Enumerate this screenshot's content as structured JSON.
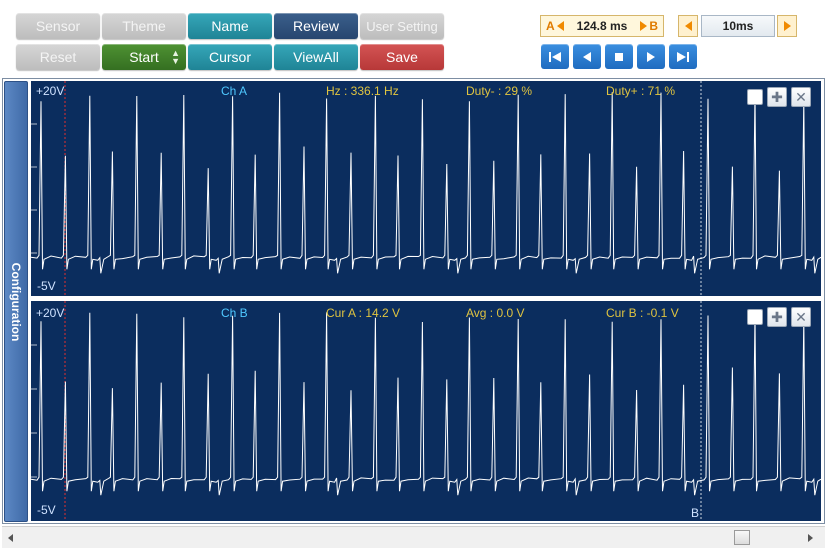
{
  "toolbar": {
    "row1": [
      {
        "id": "sensor",
        "label": "Sensor",
        "style": "gray"
      },
      {
        "id": "theme",
        "label": "Theme",
        "style": "gray"
      },
      {
        "id": "name",
        "label": "Name",
        "style": "teal"
      },
      {
        "id": "review",
        "label": "Review",
        "style": "navy"
      },
      {
        "id": "user_setting",
        "label": "User Setting",
        "style": "gray"
      }
    ],
    "row2": [
      {
        "id": "reset",
        "label": "Reset",
        "style": "gray"
      },
      {
        "id": "start",
        "label": "Start",
        "style": "green"
      },
      {
        "id": "cursor",
        "label": "Cursor",
        "style": "teal"
      },
      {
        "id": "viewall",
        "label": "ViewAll",
        "style": "teal"
      },
      {
        "id": "save",
        "label": "Save",
        "style": "red"
      }
    ],
    "cursor_delta": {
      "a_label": "A",
      "value": "124.8 ms",
      "b_label": "B"
    },
    "timebase": {
      "value": "10ms"
    },
    "playback": [
      "skip-to-start-icon",
      "step-back-icon",
      "stop-icon",
      "step-forward-icon",
      "skip-to-end-icon"
    ]
  },
  "sidebar": {
    "label": "Configuration"
  },
  "channels": [
    {
      "name": "Ch A",
      "top_scale": "+20V",
      "bottom_scale": "-5V",
      "readouts": [
        {
          "label": "Hz : 336.1 Hz"
        },
        {
          "label": "Duty- : 29 %"
        },
        {
          "label": "Duty+ : 71 %"
        }
      ]
    },
    {
      "name": "Ch B",
      "top_scale": "+20V",
      "bottom_scale": "-5V",
      "cursor_b_marker": "B",
      "readouts": [
        {
          "label": "Cur A : 14.2 V"
        },
        {
          "label": "Avg : 0.0 V"
        },
        {
          "label": "Cur B : -0.1 V"
        }
      ]
    }
  ],
  "colors": {
    "scope_bg": "#0b2d5e",
    "trace": "#ffffff",
    "grid": "#ffffff",
    "cursor_a": "#e03030",
    "cursor_b": "#ffffff",
    "label_white": "#cfe2ff",
    "label_cyan": "#4fc8ff",
    "label_yellow": "#e0c440"
  }
}
